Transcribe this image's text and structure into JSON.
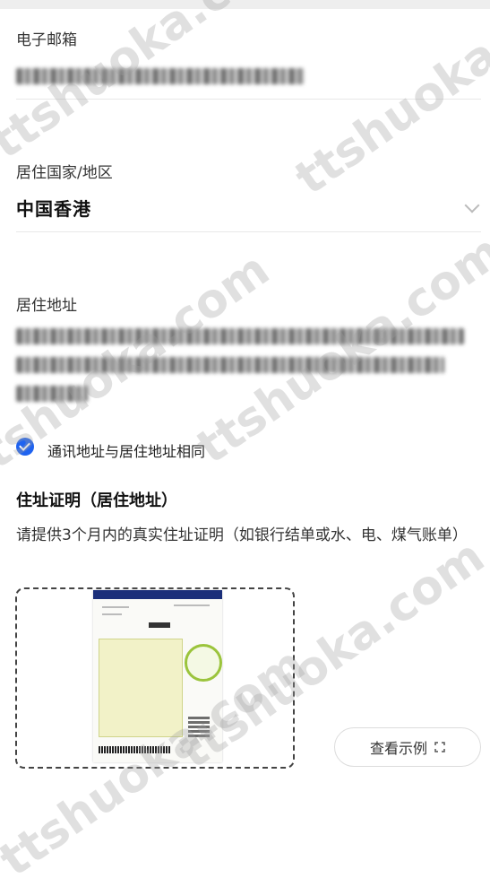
{
  "email": {
    "label": "电子邮箱"
  },
  "country": {
    "label": "居住国家/地区",
    "value": "中国香港"
  },
  "address": {
    "label": "居住地址"
  },
  "same_address": {
    "label": "通讯地址与居住地址相同",
    "checked": true
  },
  "proof": {
    "title": "住址证明（居住地址）",
    "description": "请提供3个月内的真实住址证明（如银行结单或水、电、煤气账单）",
    "example_button": "查看示例"
  },
  "watermark": {
    "text": "ttshuoka.com"
  },
  "colors": {
    "accent": "#1f63f0"
  }
}
